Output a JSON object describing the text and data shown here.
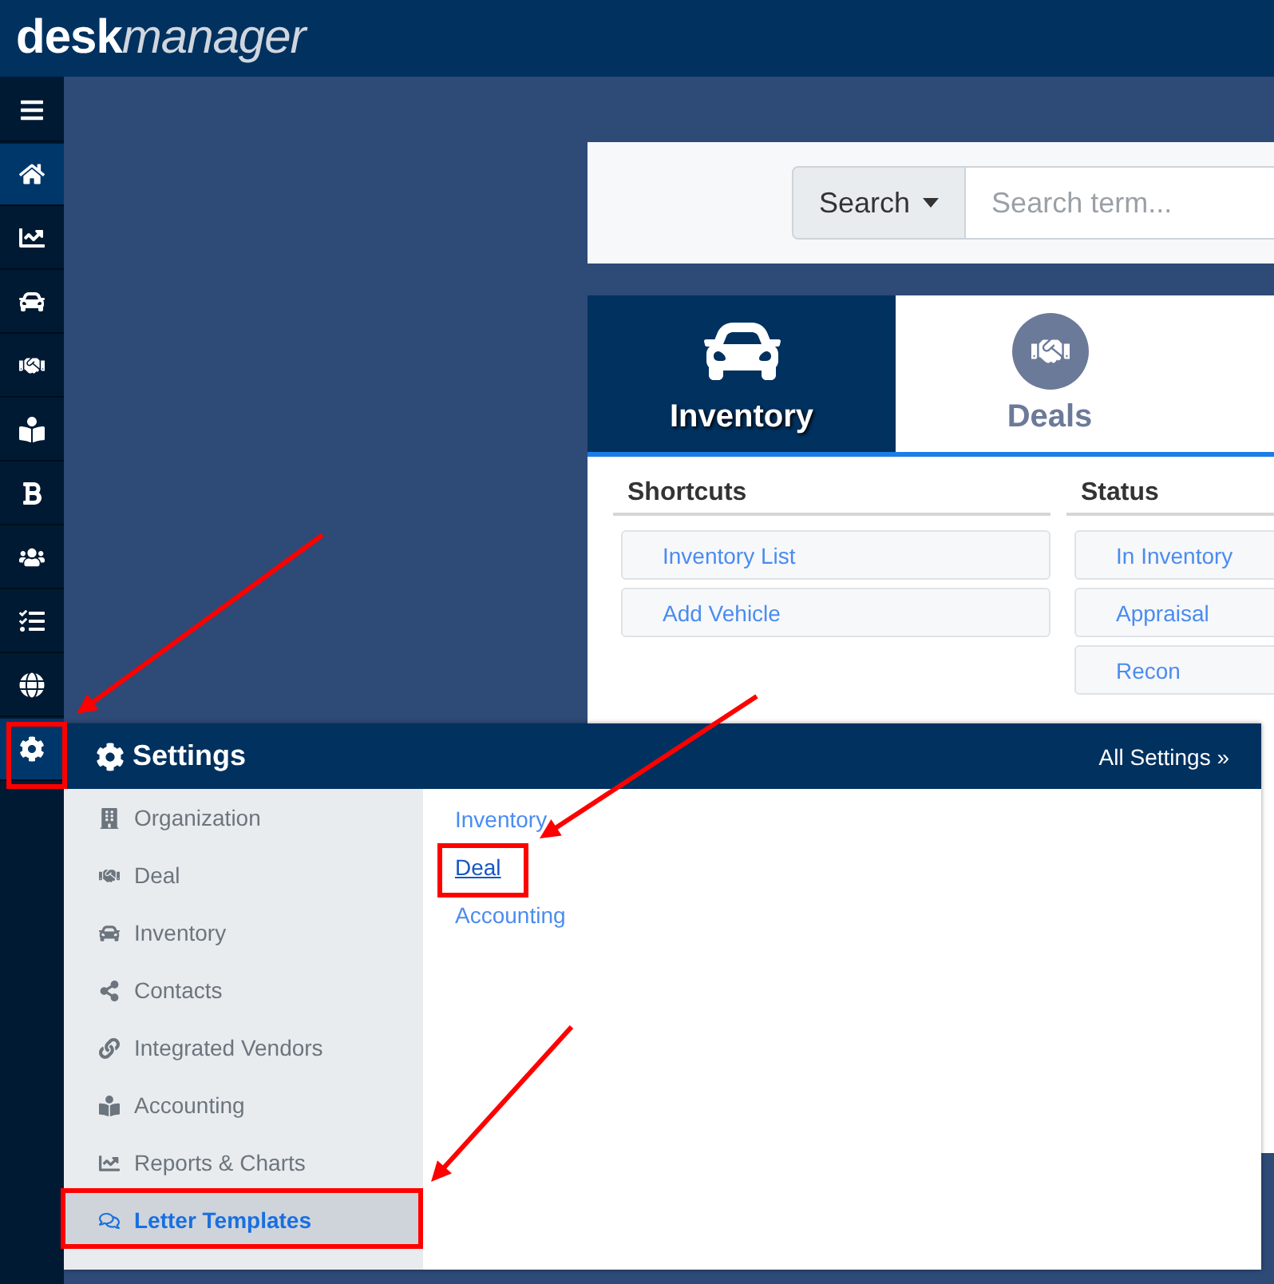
{
  "logo": {
    "bold": "desk",
    "light": "manager"
  },
  "sidebar": {
    "items": [
      {
        "selected": false
      },
      {
        "selected": true
      },
      {
        "selected": false
      },
      {
        "selected": false
      },
      {
        "selected": false
      },
      {
        "selected": false
      },
      {
        "selected": false
      },
      {
        "selected": false
      },
      {
        "selected": false
      },
      {
        "selected": false
      },
      {
        "selected": true
      }
    ]
  },
  "search": {
    "button": "Search",
    "placeholder": "Search term..."
  },
  "tabs": [
    {
      "label": "Inventory",
      "selected": true
    },
    {
      "label": "Deals",
      "selected": false
    }
  ],
  "shortcuts": {
    "title": "Shortcuts",
    "items": [
      "Inventory List",
      "Add Vehicle"
    ]
  },
  "status": {
    "title": "Status",
    "items": [
      "In Inventory",
      "Appraisal",
      "Recon"
    ]
  },
  "settings": {
    "title": "Settings",
    "all_link": "All Settings »",
    "nav": [
      {
        "label": "Organization",
        "selected": false
      },
      {
        "label": "Deal",
        "selected": false
      },
      {
        "label": "Inventory",
        "selected": false
      },
      {
        "label": "Contacts",
        "selected": false
      },
      {
        "label": "Integrated Vendors",
        "selected": false
      },
      {
        "label": "Accounting",
        "selected": false
      },
      {
        "label": "Reports & Charts",
        "selected": false
      },
      {
        "label": "Letter Templates",
        "selected": true
      }
    ],
    "links": [
      {
        "label": "Inventory",
        "selected": false
      },
      {
        "label": "Deal",
        "selected": true
      },
      {
        "label": "Accounting",
        "selected": false
      }
    ]
  }
}
